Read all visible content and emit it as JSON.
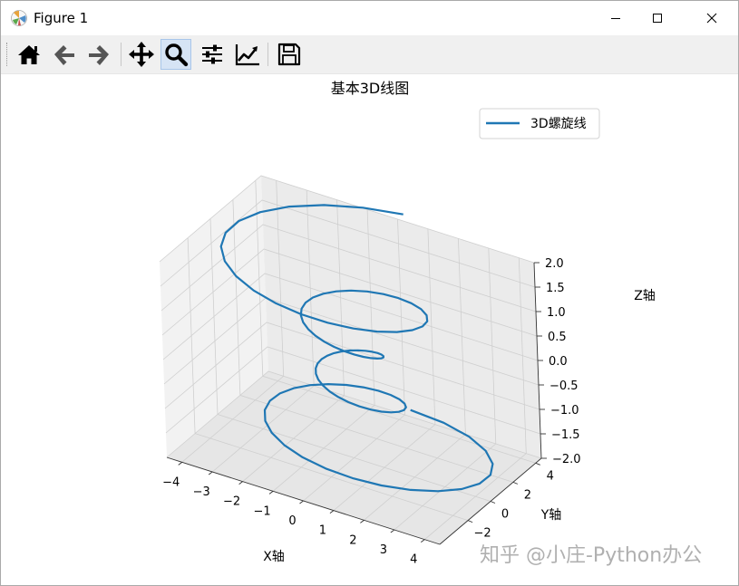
{
  "window": {
    "title": "Figure 1"
  },
  "toolbar": {
    "tools": [
      {
        "name": "home-tool",
        "icon": "home-icon"
      },
      {
        "name": "back-tool",
        "icon": "arrow-left-icon"
      },
      {
        "name": "forward-tool",
        "icon": "arrow-right-icon"
      },
      {
        "name": "pan-tool",
        "icon": "move-icon"
      },
      {
        "name": "zoom-tool",
        "icon": "magnifier-icon",
        "active": true
      },
      {
        "name": "subplots-tool",
        "icon": "sliders-icon"
      },
      {
        "name": "axes-tool",
        "icon": "line-chart-icon"
      },
      {
        "name": "save-tool",
        "icon": "floppy-disk-icon"
      }
    ]
  },
  "watermark": "知乎 @小庄-Python办公",
  "chart_data": {
    "type": "line",
    "projection": "3d",
    "title": "基本3D线图",
    "xlabel": "X轴",
    "ylabel": "Y轴",
    "zlabel": "Z轴",
    "x_ticks": [
      "−4",
      "−3",
      "−2",
      "−1",
      "0",
      "1",
      "2",
      "3",
      "4"
    ],
    "y_ticks": [
      "−2",
      "0",
      "2",
      "4"
    ],
    "z_ticks": [
      "2.0",
      "1.5",
      "1.0",
      "0.5",
      "0.0",
      "−0.5",
      "−1.0",
      "−1.5",
      "−2.0"
    ],
    "xlim": [
      -4.5,
      4.5
    ],
    "ylim": [
      -4.5,
      4.5
    ],
    "zlim": [
      -2,
      2
    ],
    "grid": true,
    "legend": {
      "position": "upper-right",
      "entries": [
        "3D螺旋线"
      ]
    },
    "series": [
      {
        "name": "3D螺旋线",
        "color": "#1f77b4",
        "equation": "theta in [-4pi, 4pi], z in [-2, 2], r = z^2 + 1, x = r*sin(theta), y = r*cos(theta)",
        "samples": 100
      }
    ]
  }
}
